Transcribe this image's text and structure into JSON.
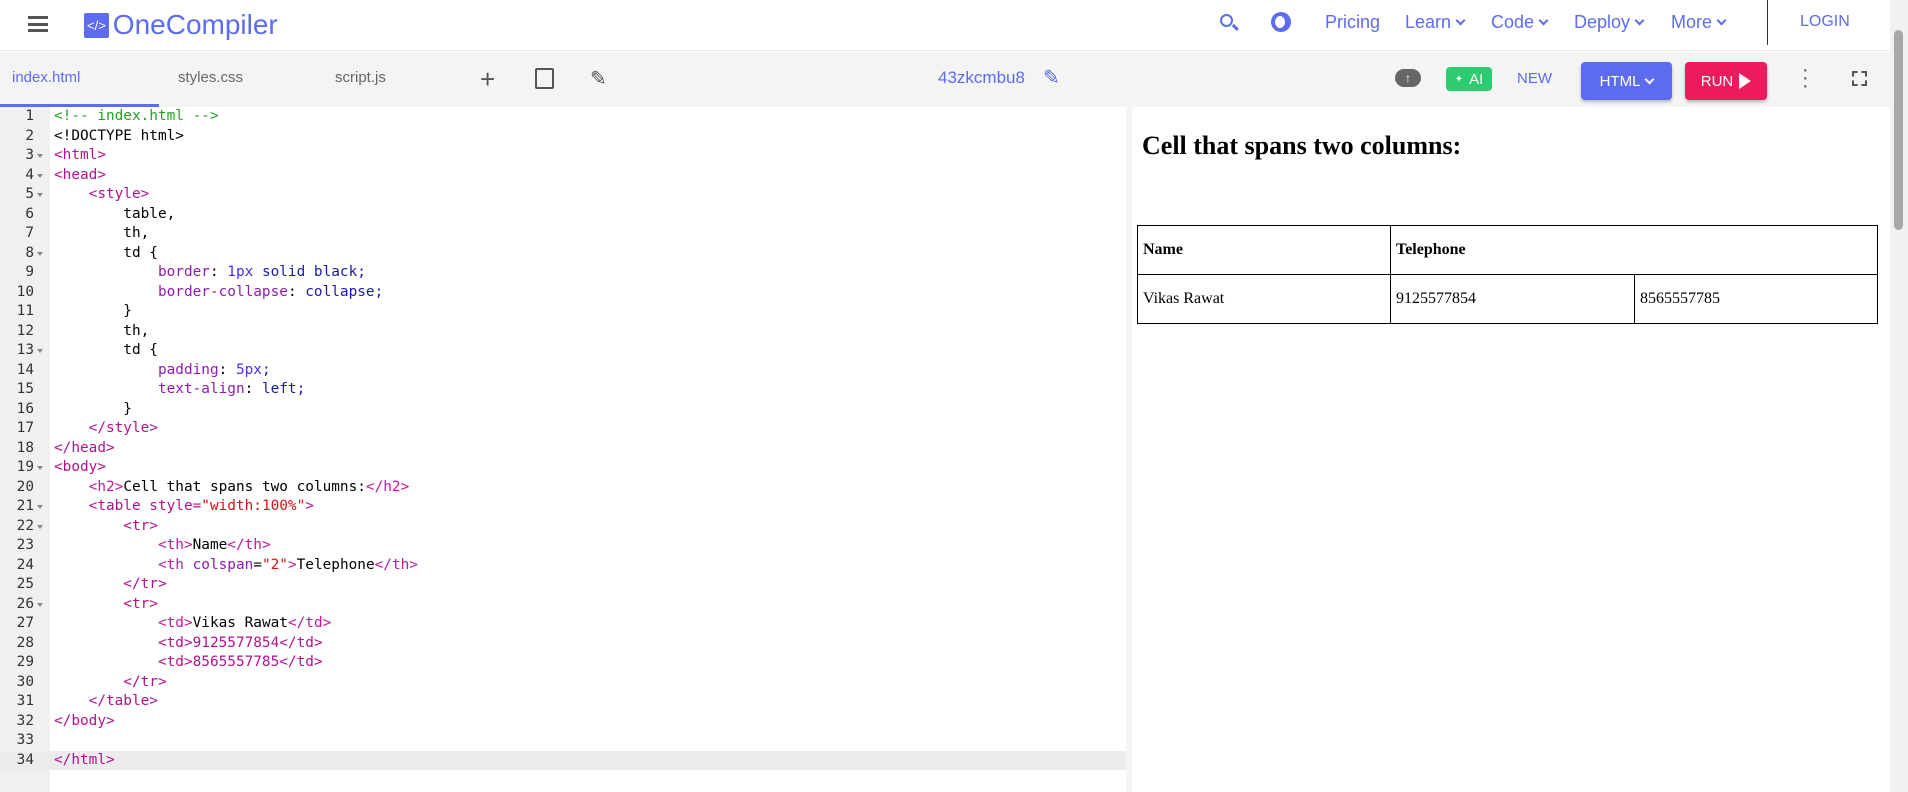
{
  "header": {
    "logo_text": "OneCompiler",
    "logo_glyph": "</>",
    "nav": [
      "Pricing",
      "Learn",
      "Code",
      "Deploy",
      "More"
    ],
    "login": "LOGIN"
  },
  "tabs": [
    "index.html",
    "styles.css",
    "script.js"
  ],
  "project_name": "43zkcmbu8",
  "toolbar": {
    "ai": "AI",
    "new": "NEW",
    "language": "HTML",
    "run": "RUN"
  },
  "code_lines": [
    "<!-- index.html -->",
    "<!DOCTYPE html>",
    "<html>",
    "<head>",
    "    <style>",
    "        table,",
    "        th,",
    "        td {",
    "            border: 1px solid black;",
    "            border-collapse: collapse;",
    "        }",
    "        th,",
    "        td {",
    "            padding: 5px;",
    "            text-align: left;",
    "        }",
    "    </style>",
    "</head>",
    "<body>",
    "    <h2>Cell that spans two columns:</h2>",
    "    <table style=\"width:100%\">",
    "        <tr>",
    "            <th>Name</th>",
    "            <th colspan=\"2\">Telephone</th>",
    "        </tr>",
    "        <tr>",
    "            <td>Vikas Rawat</td>",
    "            <td>9125577854</td>",
    "            <td>8565557785</td>",
    "        </tr>",
    "    </table>",
    "</body>",
    "",
    "</html>"
  ],
  "preview": {
    "heading": "Cell that spans two columns:",
    "headers": [
      "Name",
      "Telephone"
    ],
    "row": [
      "Vikas Rawat",
      "9125577854",
      "8565557785"
    ]
  },
  "colors": {
    "accent": "#5c6bf0",
    "run": "#ec1c5c",
    "ai": "#2ecc71"
  }
}
